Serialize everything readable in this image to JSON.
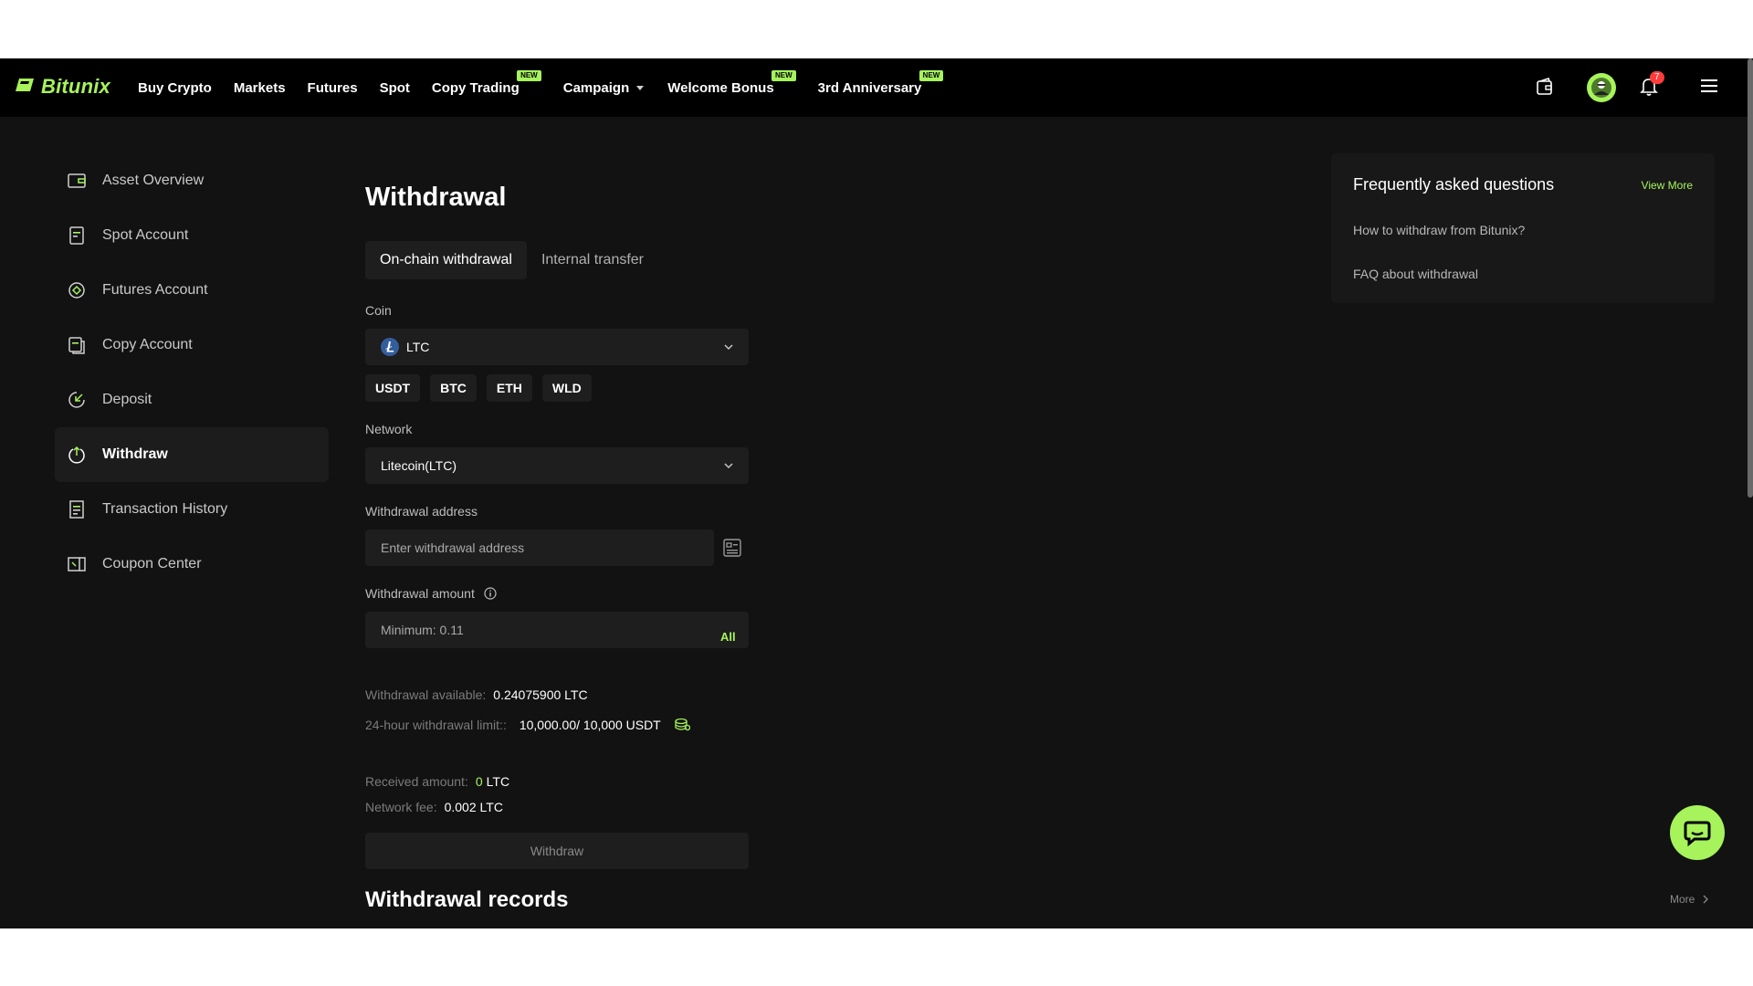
{
  "header": {
    "logo_text": "Bitunix",
    "nav": [
      {
        "label": "Buy Crypto"
      },
      {
        "label": "Markets"
      },
      {
        "label": "Futures"
      },
      {
        "label": "Spot"
      },
      {
        "label": "Copy Trading",
        "badge": "NEW"
      },
      {
        "label": "Campaign"
      },
      {
        "label": "Welcome Bonus",
        "badge": "NEW"
      },
      {
        "label": "3rd Anniversary",
        "badge": "NEW"
      }
    ],
    "notification_count": "7"
  },
  "sidebar": {
    "items": [
      {
        "label": "Asset Overview",
        "icon": "wallet-icon"
      },
      {
        "label": "Spot Account",
        "icon": "document-icon"
      },
      {
        "label": "Futures Account",
        "icon": "target-icon"
      },
      {
        "label": "Copy Account",
        "icon": "copy-icon"
      },
      {
        "label": "Deposit",
        "icon": "deposit-icon"
      },
      {
        "label": "Withdraw",
        "icon": "withdraw-icon",
        "active": true
      },
      {
        "label": "Transaction History",
        "icon": "receipt-icon"
      },
      {
        "label": "Coupon Center",
        "icon": "coupon-icon"
      }
    ]
  },
  "main": {
    "title": "Withdrawal",
    "tabs": [
      "On-chain withdrawal",
      "Internal transfer"
    ],
    "coin_label": "Coin",
    "coin_value": "LTC",
    "quick_coins": [
      "USDT",
      "BTC",
      "ETH",
      "WLD"
    ],
    "network_label": "Network",
    "network_value": "Litecoin(LTC)",
    "address_label": "Withdrawal address",
    "address_placeholder": "Enter withdrawal address",
    "amount_label": "Withdrawal amount",
    "amount_placeholder": "Minimum: 0.11",
    "all_label": "All",
    "available_label": "Withdrawal available:",
    "available_value": "0.24075900 LTC",
    "limit_label": "24-hour withdrawal limit::",
    "limit_value": "10,000.00/ 10,000 USDT",
    "received_label": "Received amount:",
    "received_value": "0",
    "received_unit": "LTC",
    "fee_label": "Network fee:",
    "fee_value": "0.002 LTC",
    "withdraw_button": "Withdraw",
    "records_title": "Withdrawal records",
    "more_label": "More"
  },
  "faq": {
    "title": "Frequently asked questions",
    "view_more": "View More",
    "links": [
      "How to withdraw from Bitunix?",
      "FAQ about withdrawal"
    ]
  },
  "colors": {
    "accent": "#a6f35b",
    "background": "#121212",
    "header": "#000000",
    "panel": "#1e1e1e"
  }
}
